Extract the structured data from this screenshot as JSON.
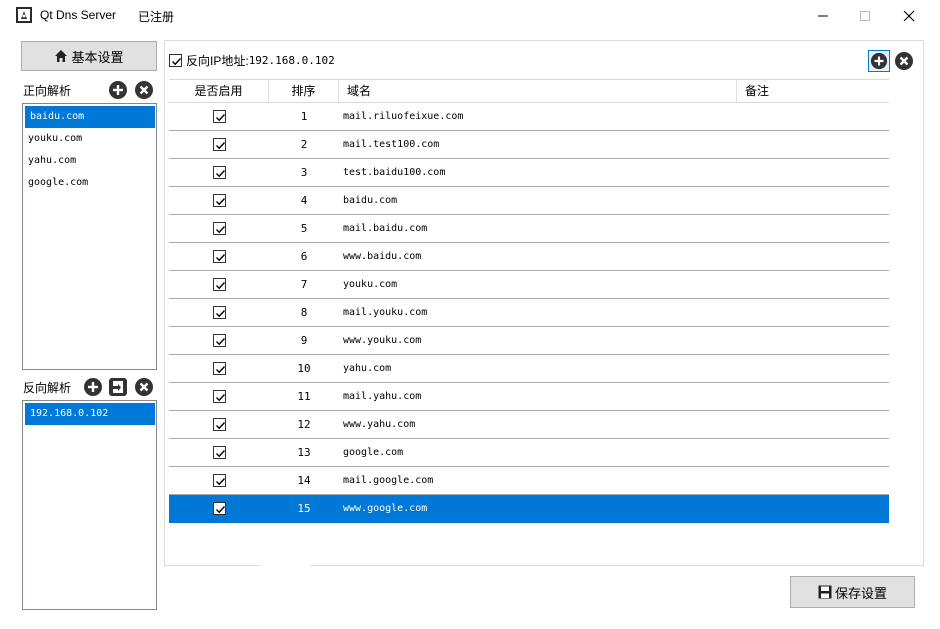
{
  "window": {
    "title": "Qt Dns Server",
    "status": "已注册"
  },
  "basic_settings_button": "基本设置",
  "forward": {
    "label": "正向解析",
    "items": [
      "baidu.com",
      "youku.com",
      "yahu.com",
      "google.com"
    ],
    "selected_index": 0
  },
  "reverse": {
    "label": "反向解析",
    "items": [
      "192.168.0.102"
    ],
    "selected_index": 0
  },
  "right": {
    "reverse_checkbox_label": "反向IP地址:",
    "reverse_ip": "192.168.0.102",
    "reverse_checked": true
  },
  "table": {
    "headers": [
      "是否启用",
      "排序",
      "域名",
      "备注"
    ],
    "rows": [
      {
        "enabled": true,
        "order": "1",
        "domain": "mail.riluofeixue.com",
        "note": ""
      },
      {
        "enabled": true,
        "order": "2",
        "domain": "mail.test100.com",
        "note": ""
      },
      {
        "enabled": true,
        "order": "3",
        "domain": "test.baidu100.com",
        "note": ""
      },
      {
        "enabled": true,
        "order": "4",
        "domain": "baidu.com",
        "note": ""
      },
      {
        "enabled": true,
        "order": "5",
        "domain": "mail.baidu.com",
        "note": ""
      },
      {
        "enabled": true,
        "order": "6",
        "domain": "www.baidu.com",
        "note": ""
      },
      {
        "enabled": true,
        "order": "7",
        "domain": "youku.com",
        "note": ""
      },
      {
        "enabled": true,
        "order": "8",
        "domain": "mail.youku.com",
        "note": ""
      },
      {
        "enabled": true,
        "order": "9",
        "domain": "www.youku.com",
        "note": ""
      },
      {
        "enabled": true,
        "order": "10",
        "domain": "yahu.com",
        "note": ""
      },
      {
        "enabled": true,
        "order": "11",
        "domain": "mail.yahu.com",
        "note": ""
      },
      {
        "enabled": true,
        "order": "12",
        "domain": "www.yahu.com",
        "note": ""
      },
      {
        "enabled": true,
        "order": "13",
        "domain": "google.com",
        "note": ""
      },
      {
        "enabled": true,
        "order": "14",
        "domain": "mail.google.com",
        "note": ""
      },
      {
        "enabled": true,
        "order": "15",
        "domain": "www.google.com",
        "note": ""
      }
    ],
    "selected_index": 14
  },
  "save_button": "保存设置",
  "colors": {
    "selection": "#0078d7",
    "button_face": "#e1e1e1"
  },
  "icons": {
    "home": "home-icon",
    "add": "add-icon",
    "remove": "remove-icon",
    "import": "import-icon",
    "save": "floppy-disk-icon"
  }
}
